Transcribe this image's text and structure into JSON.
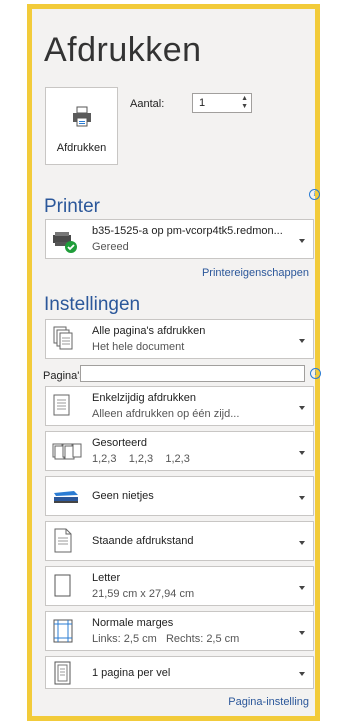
{
  "title": "Afdrukken",
  "print_button": {
    "label": "Afdrukken",
    "icon": "printer-icon"
  },
  "copies": {
    "label": "Aantal:",
    "value": "1"
  },
  "printer": {
    "heading": "Printer",
    "name": "b35-1525-a op pm-vcorp4tk5.redmon...",
    "status": "Gereed",
    "properties_link": "Printereigenschappen"
  },
  "settings": {
    "heading": "Instellingen",
    "pages_label": "Pagina's:",
    "pages_value": "",
    "items": [
      {
        "title": "Alle pagina's afdrukken",
        "subtitle": "Het hele document",
        "icon": "pages-icon"
      },
      {
        "title": "Enkelzijdig afdrukken",
        "subtitle": "Alleen afdrukken op één zijd...",
        "icon": "single-sided-icon"
      },
      {
        "title": "Gesorteerd",
        "subtitle": "1,2,3    1,2,3    1,2,3",
        "icon": "collated-icon"
      },
      {
        "title": "Geen nietjes",
        "subtitle": "",
        "icon": "stapler-icon"
      },
      {
        "title": "Staande afdrukstand",
        "subtitle": "",
        "icon": "portrait-icon"
      },
      {
        "title": "Letter",
        "subtitle": "21,59 cm x 27,94 cm",
        "icon": "paper-size-icon"
      },
      {
        "title": "Normale marges",
        "subtitle": "Links: 2,5 cm   Rechts: 2,5 cm",
        "icon": "margins-icon"
      },
      {
        "title": "1 pagina per vel",
        "subtitle": "",
        "icon": "pages-per-sheet-icon"
      }
    ],
    "page_setup_link": "Pagina-instelling"
  }
}
